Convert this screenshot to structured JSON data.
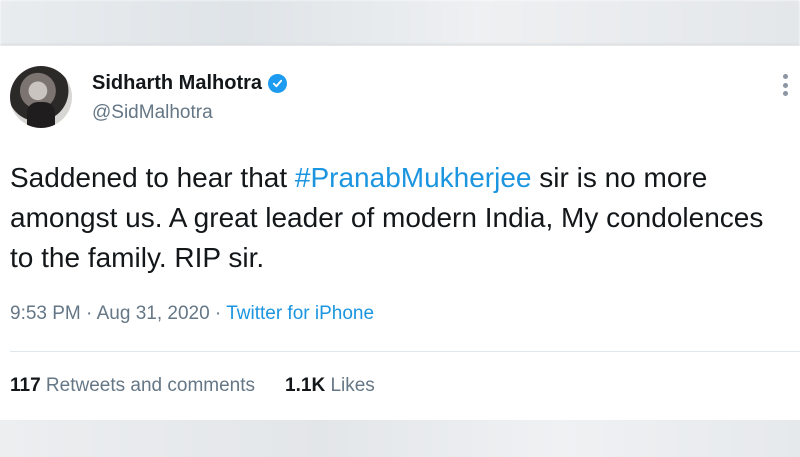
{
  "tweet": {
    "name": "Sidharth Malhotra",
    "handle": "@SidMalhotra",
    "text_before": "Saddened to hear that ",
    "hashtag": "#PranabMukherjee",
    "text_after": " sir is no more amongst us. A great leader of modern India, My condolences to the family. RIP sir.",
    "time": "9:53 PM",
    "separator": " · ",
    "date": "Aug 31, 2020",
    "source": "Twitter for iPhone"
  },
  "stats": {
    "retweets_count": "117",
    "retweets_label": " Retweets and comments",
    "likes_count": "1.1K",
    "likes_label": " Likes"
  },
  "colors": {
    "accent": "#1b95e0",
    "verified": "#1d9bf0",
    "muted": "#657786"
  },
  "icons": {
    "verified": "verified-badge-icon",
    "more": "more-options-icon"
  }
}
